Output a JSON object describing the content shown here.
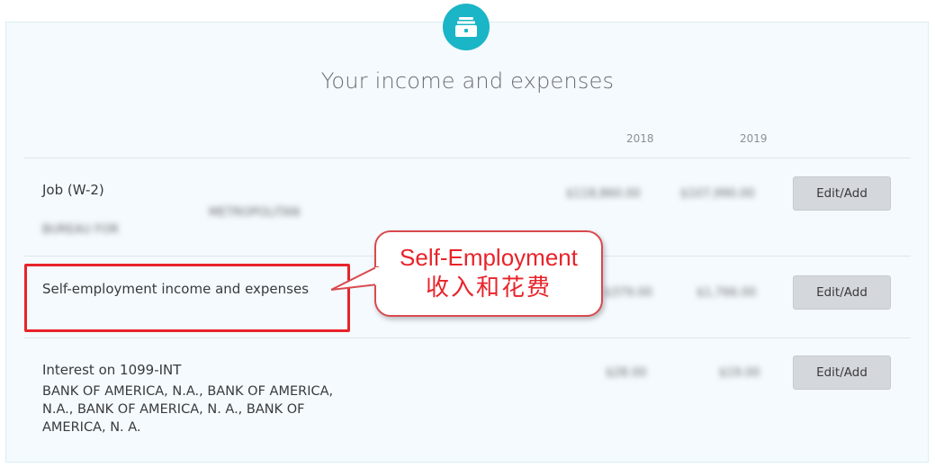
{
  "header": {
    "icon": "cash-drawer-icon",
    "title": "Your income and expenses",
    "accent_color": "#1ab5c6"
  },
  "columns": {
    "year1": "2018",
    "year2": "2019"
  },
  "rows": [
    {
      "title": "Job (W-2)",
      "amount_2018": "$118,860.00",
      "amount_2019": "$107,990.00",
      "sub_blurred": "METROPOLITAN",
      "detail_blurred": "BUREAU FOR",
      "button": "Edit/Add"
    },
    {
      "title": "Self-employment income and expenses",
      "amount_2018": "$379.00",
      "amount_2019": "$1,766.00",
      "button": "Edit/Add"
    },
    {
      "title": "Interest on 1099-INT",
      "detail": "BANK OF AMERICA, N.A., BANK OF AMERICA, N.A., BANK OF AMERICA, N. A., BANK OF AMERICA, N. A.",
      "amount_2018": "$28.00",
      "amount_2019": "$19.00",
      "button": "Edit/Add"
    }
  ],
  "annotation": {
    "line1": "Self-Employment",
    "line2": "收入和花费",
    "color": "#e8232a"
  }
}
